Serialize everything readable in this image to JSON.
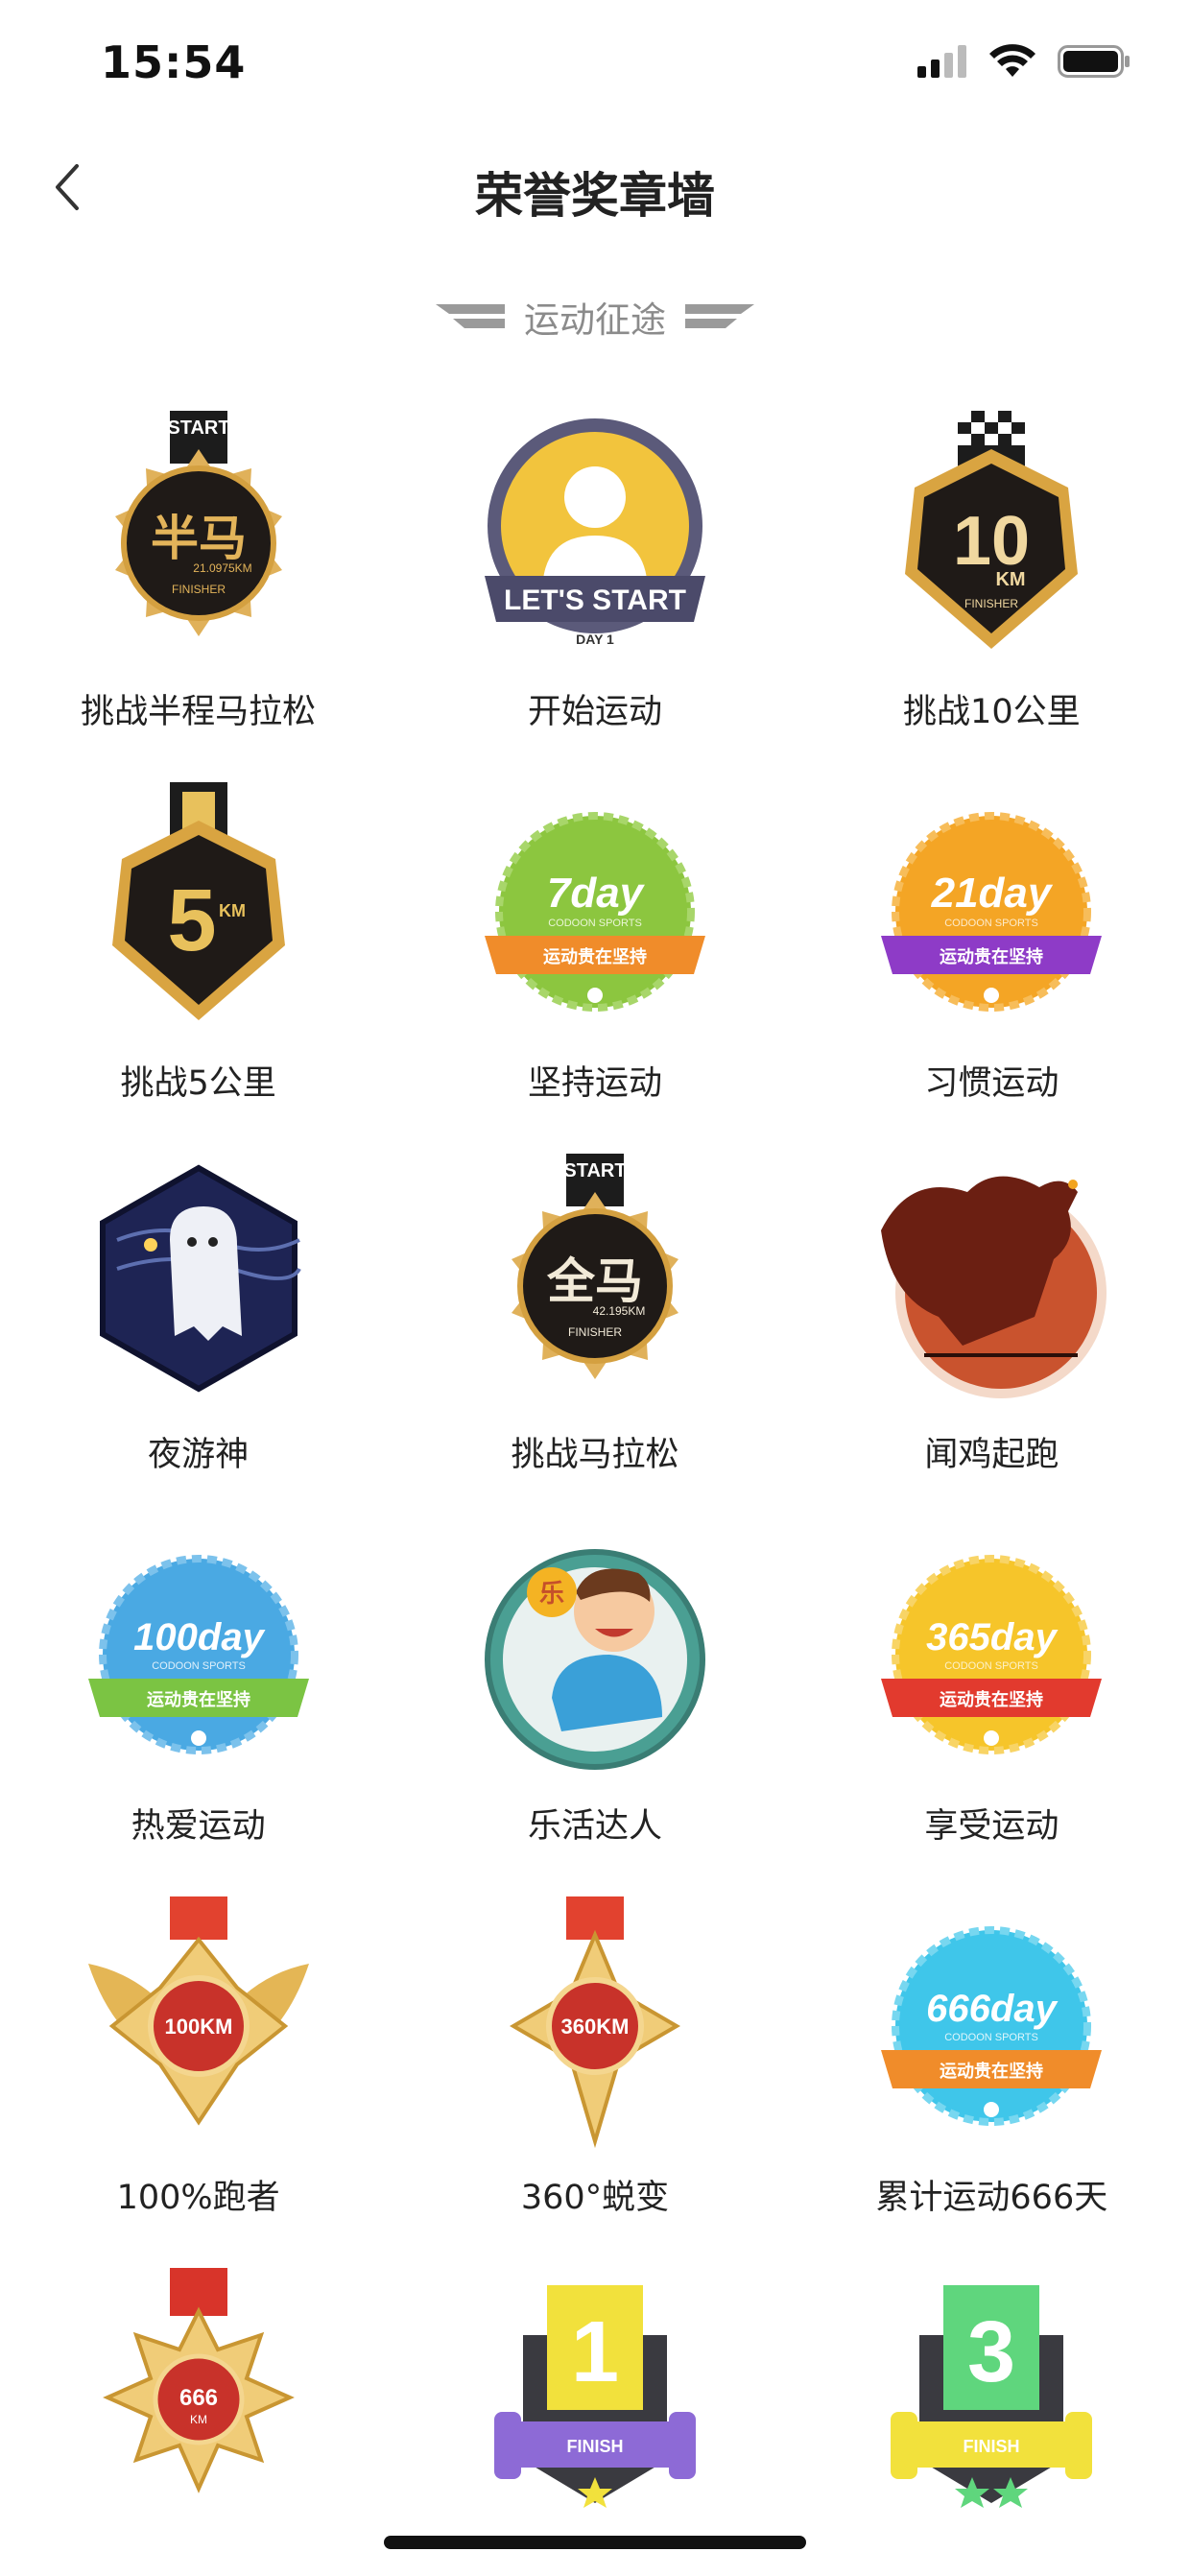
{
  "status_bar": {
    "time": "15:54"
  },
  "nav": {
    "title": "荣誉奖章墙"
  },
  "section": {
    "title": "运动征途"
  },
  "badges": [
    {
      "label": "挑战半程马拉松",
      "icon": "half-marathon-medal",
      "text_main": "半马",
      "text_sub": "21.0975KM",
      "text_tag": "START",
      "text_foot": "FINISHER"
    },
    {
      "label": "开始运动",
      "icon": "lets-start-badge",
      "text_main": "LET'S START",
      "text_sub": "DAY 1"
    },
    {
      "label": "挑战10公里",
      "icon": "10km-medal",
      "text_main": "10",
      "text_sub": "KM",
      "text_foot": "FINISHER"
    },
    {
      "label": "挑战5公里",
      "icon": "5km-medal",
      "text_main": "5",
      "text_sub": "KM"
    },
    {
      "label": "坚持运动",
      "icon": "7day-badge",
      "text_main": "7day",
      "text_sub": "CODOON SPORTS",
      "text_ribbon": "运动贵在坚持",
      "color": "#8cc63f",
      "ribbon": "#f08c2a"
    },
    {
      "label": "习惯运动",
      "icon": "21day-badge",
      "text_main": "21day",
      "text_sub": "CODOON SPORTS",
      "text_ribbon": "运动贵在坚持",
      "color": "#f4a525",
      "ribbon": "#8e3bc7"
    },
    {
      "label": "夜游神",
      "icon": "night-ghost-badge"
    },
    {
      "label": "挑战马拉松",
      "icon": "marathon-medal",
      "text_main": "全马",
      "text_sub": "42.195KM",
      "text_tag": "START",
      "text_foot": "FINISHER"
    },
    {
      "label": "闻鸡起跑",
      "icon": "rooster-badge"
    },
    {
      "label": "热爱运动",
      "icon": "100day-badge",
      "text_main": "100day",
      "text_sub": "CODOON SPORTS",
      "text_ribbon": "运动贵在坚持",
      "color": "#4aa9e3",
      "ribbon": "#7bc443"
    },
    {
      "label": "乐活达人",
      "icon": "happy-person-badge",
      "text_main": "乐"
    },
    {
      "label": "享受运动",
      "icon": "365day-badge",
      "text_main": "365day",
      "text_sub": "CODOON SPORTS",
      "text_ribbon": "运动贵在坚持",
      "color": "#f6c52a",
      "ribbon": "#e23a2e"
    },
    {
      "label": "100%跑者",
      "icon": "100km-winged-medal",
      "text_main": "100KM"
    },
    {
      "label": "360°蜕变",
      "icon": "360km-star-medal",
      "text_main": "360KM"
    },
    {
      "label": "累计运动666天",
      "icon": "666day-badge",
      "text_main": "666day",
      "text_sub": "CODOON SPORTS",
      "text_ribbon": "运动贵在坚持",
      "color": "#3fc6ea",
      "ribbon": "#f08c2a"
    },
    {
      "label": "",
      "icon": "666km-medal",
      "text_main": "666",
      "text_sub": "KM"
    },
    {
      "label": "",
      "icon": "fitness-1-badge",
      "text_main": "1",
      "text_sub": "FINISH",
      "color": "#f2e13c",
      "stars": 1
    },
    {
      "label": "",
      "icon": "fitness-3-badge",
      "text_main": "3",
      "text_sub": "FINISH",
      "color": "#5fd67d",
      "stars": 2
    }
  ],
  "colors": {
    "title": "#222222",
    "section": "#8b8b8b",
    "gold": "#d9a441",
    "dark": "#1f1a17"
  }
}
